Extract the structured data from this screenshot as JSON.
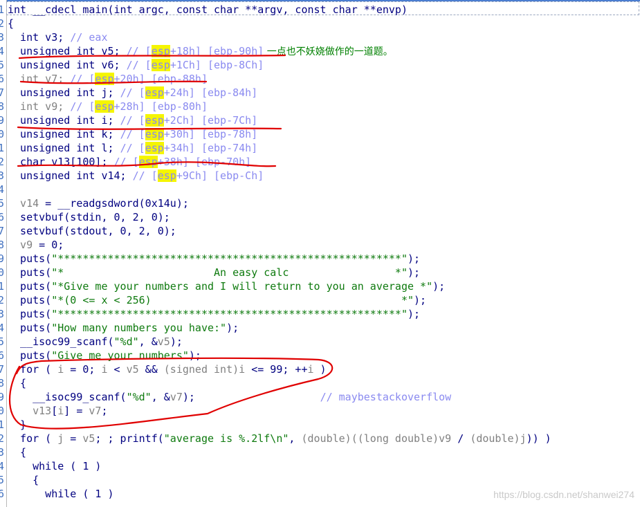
{
  "viewer": {
    "line_numbers": [
      "1",
      "2",
      "3",
      "4",
      "5",
      "6",
      "7",
      "8",
      "9",
      "0",
      "1",
      "2",
      "3",
      "4",
      "5",
      "6",
      "7",
      "8",
      "9",
      "0",
      "1",
      "2",
      "3",
      "4",
      "5",
      "6",
      "7",
      "8",
      "9",
      "0",
      "1",
      "2",
      "3",
      "4",
      "5",
      "6"
    ]
  },
  "code": {
    "l1_a": "int __cdecl main(int argc, const char **argv, const char **envp)",
    "l2_a": "{",
    "l3_a": "  int v3; ",
    "l3_c": "// eax",
    "l4_a": "  unsigned int v5; ",
    "l4_c1": "// [",
    "l4_h": "esp",
    "l4_c2": "+18h] [ebp-90h]",
    "l4_note": " 一点也不妖娆做作的一道题。",
    "l5_a": "  unsigned int v6; ",
    "l5_c1": "// [",
    "l5_h": "esp",
    "l5_c2": "+1Ch] [ebp-8Ch]",
    "l6_a": "  int v7; ",
    "l6_c1": "// [",
    "l6_h": "esp",
    "l6_c2": "+20h] [ebp-88h]",
    "l7_a": "  unsigned int j; ",
    "l7_c1": "// [",
    "l7_h": "esp",
    "l7_c2": "+24h] [ebp-84h]",
    "l8_a": "  int v9; ",
    "l8_c1": "// [",
    "l8_h": "esp",
    "l8_c2": "+28h] [ebp-80h]",
    "l9_a": "  unsigned int i; ",
    "l9_c1": "// [",
    "l9_h": "esp",
    "l9_c2": "+2Ch] [ebp-7Ch]",
    "l10_a": "  unsigned int k; ",
    "l10_c1": "// [",
    "l10_h": "esp",
    "l10_c2": "+30h] [ebp-78h]",
    "l11_a": "  unsigned int l; ",
    "l11_c1": "// [",
    "l11_h": "esp",
    "l11_c2": "+34h] [ebp-74h]",
    "l12_a": "  char v13[100]; ",
    "l12_c1": "// [",
    "l12_h": "esp",
    "l12_c2": "+38h] [ebp-70h]",
    "l13_a": "  unsigned int v14; ",
    "l13_c1": "// [",
    "l13_h": "esp",
    "l13_c2": "+9Ch] [ebp-Ch]",
    "l14_a": "",
    "l15_v": "  v14",
    "l15_a": " = __readgsdword(0x14u);",
    "l16_a": "  setvbuf(stdin, 0, 2, 0);",
    "l17_a": "  setvbuf(stdout, 0, 2, 0);",
    "l18_v": "  v9",
    "l18_a": " = 0;",
    "l19_a": "  puts(",
    "l19_s": "\"*******************************************************\"",
    "l19_b": ");",
    "l20_a": "  puts(",
    "l20_s": "\"*                        An easy calc                 *\"",
    "l20_b": ");",
    "l21_a": "  puts(",
    "l21_s": "\"*Give me your numbers and I will return to you an average *\"",
    "l21_b": ");",
    "l22_a": "  puts(",
    "l22_s": "\"*(0 <= x < 256)                                        *\"",
    "l22_b": ");",
    "l23_a": "  puts(",
    "l23_s": "\"*******************************************************\"",
    "l23_b": ");",
    "l24_a": "  puts(",
    "l24_s": "\"How many numbers you have:\"",
    "l24_b": ");",
    "l25_a": "  __isoc99_scanf(",
    "l25_s": "\"%d\"",
    "l25_b": ", &",
    "l25_v": "v5",
    "l25_c": ");",
    "l26_a": "  puts(",
    "l26_s": "\"Give me your numbers\"",
    "l26_b": ");",
    "l27_a": "  for ( ",
    "l27_v1": "i",
    "l27_b": " = 0; ",
    "l27_v2": "i",
    "l27_c": " < ",
    "l27_v3": "v5",
    "l27_d": " && ",
    "l27_e": "(signed int)",
    "l27_v4": "i",
    "l27_f": " <= 99; ++",
    "l27_v5": "i",
    "l27_g": " )",
    "l28_a": "  {",
    "l29_a": "    __isoc99_scanf(",
    "l29_s": "\"%d\"",
    "l29_b": ", &",
    "l29_v": "v7",
    "l29_c": ");",
    "l29_pad": "                    ",
    "l29_cm": "// maybestackoverflow",
    "l30_v1": "    v13",
    "l30_a": "[",
    "l30_v2": "i",
    "l30_b": "] = ",
    "l30_v3": "v7",
    "l30_c": ";",
    "l31_a": "  }",
    "l32_a": "  for ( ",
    "l32_v1": "j",
    "l32_b": " = ",
    "l32_v2": "v5",
    "l32_c": "; ; printf(",
    "l32_s": "\"average is %.2lf\\n\"",
    "l32_d": ", ",
    "l32_e": "(double)((long double)",
    "l32_v3": "v9",
    "l32_f": " / ",
    "l32_g": "(double)",
    "l32_v4": "j",
    "l32_h": ")) )",
    "l33_a": "  {",
    "l34_a": "    while ( 1 )",
    "l35_a": "    {",
    "l36_a": "      while ( 1 )"
  },
  "watermark": "https://blog.csdn.net/shanwei274",
  "colors": {
    "keyword": "#000080",
    "variable": "#808080",
    "comment": "#8a8af0",
    "string": "#0e7a0e",
    "highlight": "#f5f500",
    "annotation_ink": "#e00000"
  }
}
